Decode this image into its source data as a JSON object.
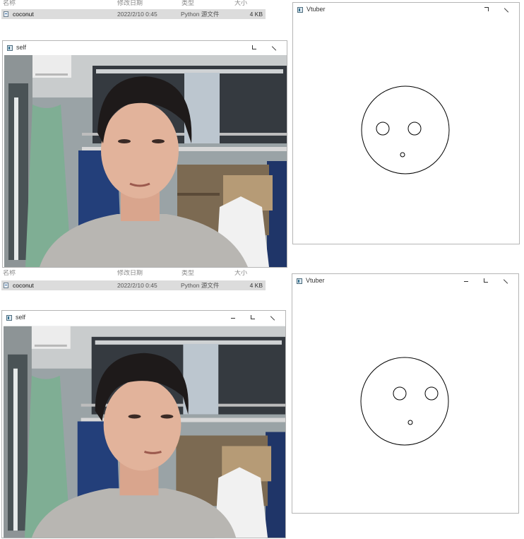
{
  "explorer_top": {
    "headers": [
      "名称",
      "修改日期",
      "类型",
      "大小"
    ],
    "file": {
      "name": "coconut",
      "date": "2022/2/10 0:45",
      "type": "Python 源文件",
      "size": "4 KB"
    }
  },
  "explorer_bottom": {
    "headers": [
      "名称",
      "修改日期",
      "类型",
      "大小"
    ],
    "file": {
      "name": "coconut",
      "date": "2022/2/10 0:45",
      "type": "Python 源文件",
      "size": "4 KB"
    }
  },
  "windows": {
    "self_top": {
      "title": "self"
    },
    "vtuber_top": {
      "title": "Vtuber"
    },
    "self_bottom": {
      "title": "self"
    },
    "vtuber_bottom": {
      "title": "Vtuber"
    }
  }
}
